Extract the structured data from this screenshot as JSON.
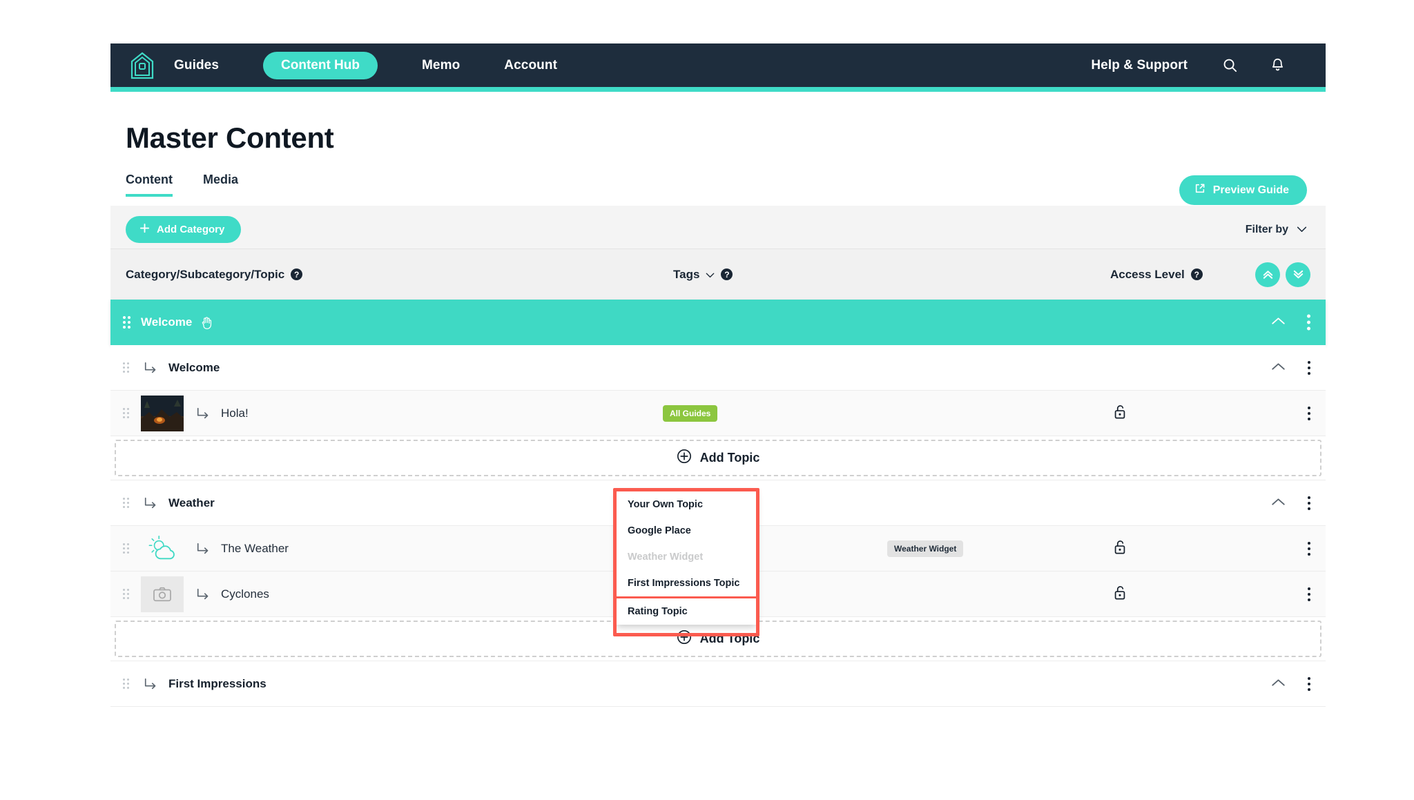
{
  "navbar": {
    "logo_name": "home-logo-icon",
    "links": [
      {
        "label": "Guides",
        "active": false
      },
      {
        "label": "Content Hub",
        "active": true
      },
      {
        "label": "Memo",
        "active": false
      },
      {
        "label": "Account",
        "active": false
      }
    ],
    "help_label": "Help & Support",
    "search_icon": "search-icon",
    "bell_icon": "notification-bell-icon",
    "bg_color": "#1e2d3d",
    "accent_color": "#3fdbc7"
  },
  "page": {
    "title": "Master Content",
    "tabs": [
      {
        "label": "Content",
        "active": true
      },
      {
        "label": "Media",
        "active": false
      }
    ],
    "preview_button": "Preview Guide",
    "add_category_button": "Add Category",
    "filter_by": "Filter by"
  },
  "columns": {
    "category": "Category/Subcategory/Topic",
    "tags": "Tags",
    "access_level": "Access Level",
    "help_glyph": "?",
    "collapse_all_icon": "chevron-double-up-icon",
    "expand_all_icon": "chevron-double-down-icon"
  },
  "rows": [
    {
      "kind": "category",
      "label": "Welcome",
      "hand_icon": "hand-drag-icon",
      "chevron": "chevron-up-icon",
      "kebab": "kebab-menu-icon"
    },
    {
      "kind": "subcategory",
      "label": "Welcome",
      "chevron": "chevron-up-icon",
      "kebab": "kebab-menu-icon"
    },
    {
      "kind": "topic",
      "label": "Hola!",
      "thumbnail": "campfire-photo-thumbnail",
      "tag": "All Guides",
      "tag_style": "green",
      "lock": "unlocked-padlock-icon",
      "kebab": "kebab-menu-icon"
    },
    {
      "kind": "add",
      "label": "Add Topic",
      "icon": "plus-circle-icon"
    },
    {
      "kind": "subcategory",
      "label": "Weather",
      "chevron": "chevron-up-icon",
      "kebab": "kebab-menu-icon"
    },
    {
      "kind": "topic",
      "label": "The Weather",
      "thumbnail": "weather-sun-cloud-icon",
      "tag": "Weather Widget",
      "tag_style": "grey",
      "lock": "unlocked-padlock-icon",
      "kebab": "kebab-menu-icon"
    },
    {
      "kind": "topic",
      "label": "Cyclones",
      "thumbnail": "camera-placeholder-icon",
      "tag": "",
      "tag_style": "none",
      "lock": "unlocked-padlock-icon",
      "kebab": "kebab-menu-icon"
    },
    {
      "kind": "add",
      "label": "Add Topic",
      "icon": "plus-circle-icon"
    },
    {
      "kind": "subcategory",
      "label": "First Impressions",
      "chevron": "chevron-up-icon",
      "kebab": "kebab-menu-icon"
    }
  ],
  "dropdown": {
    "highlight_color": "#fb5b4f",
    "items": [
      {
        "label": "Your Own Topic",
        "disabled": false,
        "highlight": false
      },
      {
        "label": "Google Place",
        "disabled": false,
        "highlight": false
      },
      {
        "label": "Weather Widget",
        "disabled": true,
        "highlight": false
      },
      {
        "label": "First Impressions Topic",
        "disabled": false,
        "highlight": false
      },
      {
        "label": "Rating Topic",
        "disabled": false,
        "highlight": true
      }
    ]
  }
}
